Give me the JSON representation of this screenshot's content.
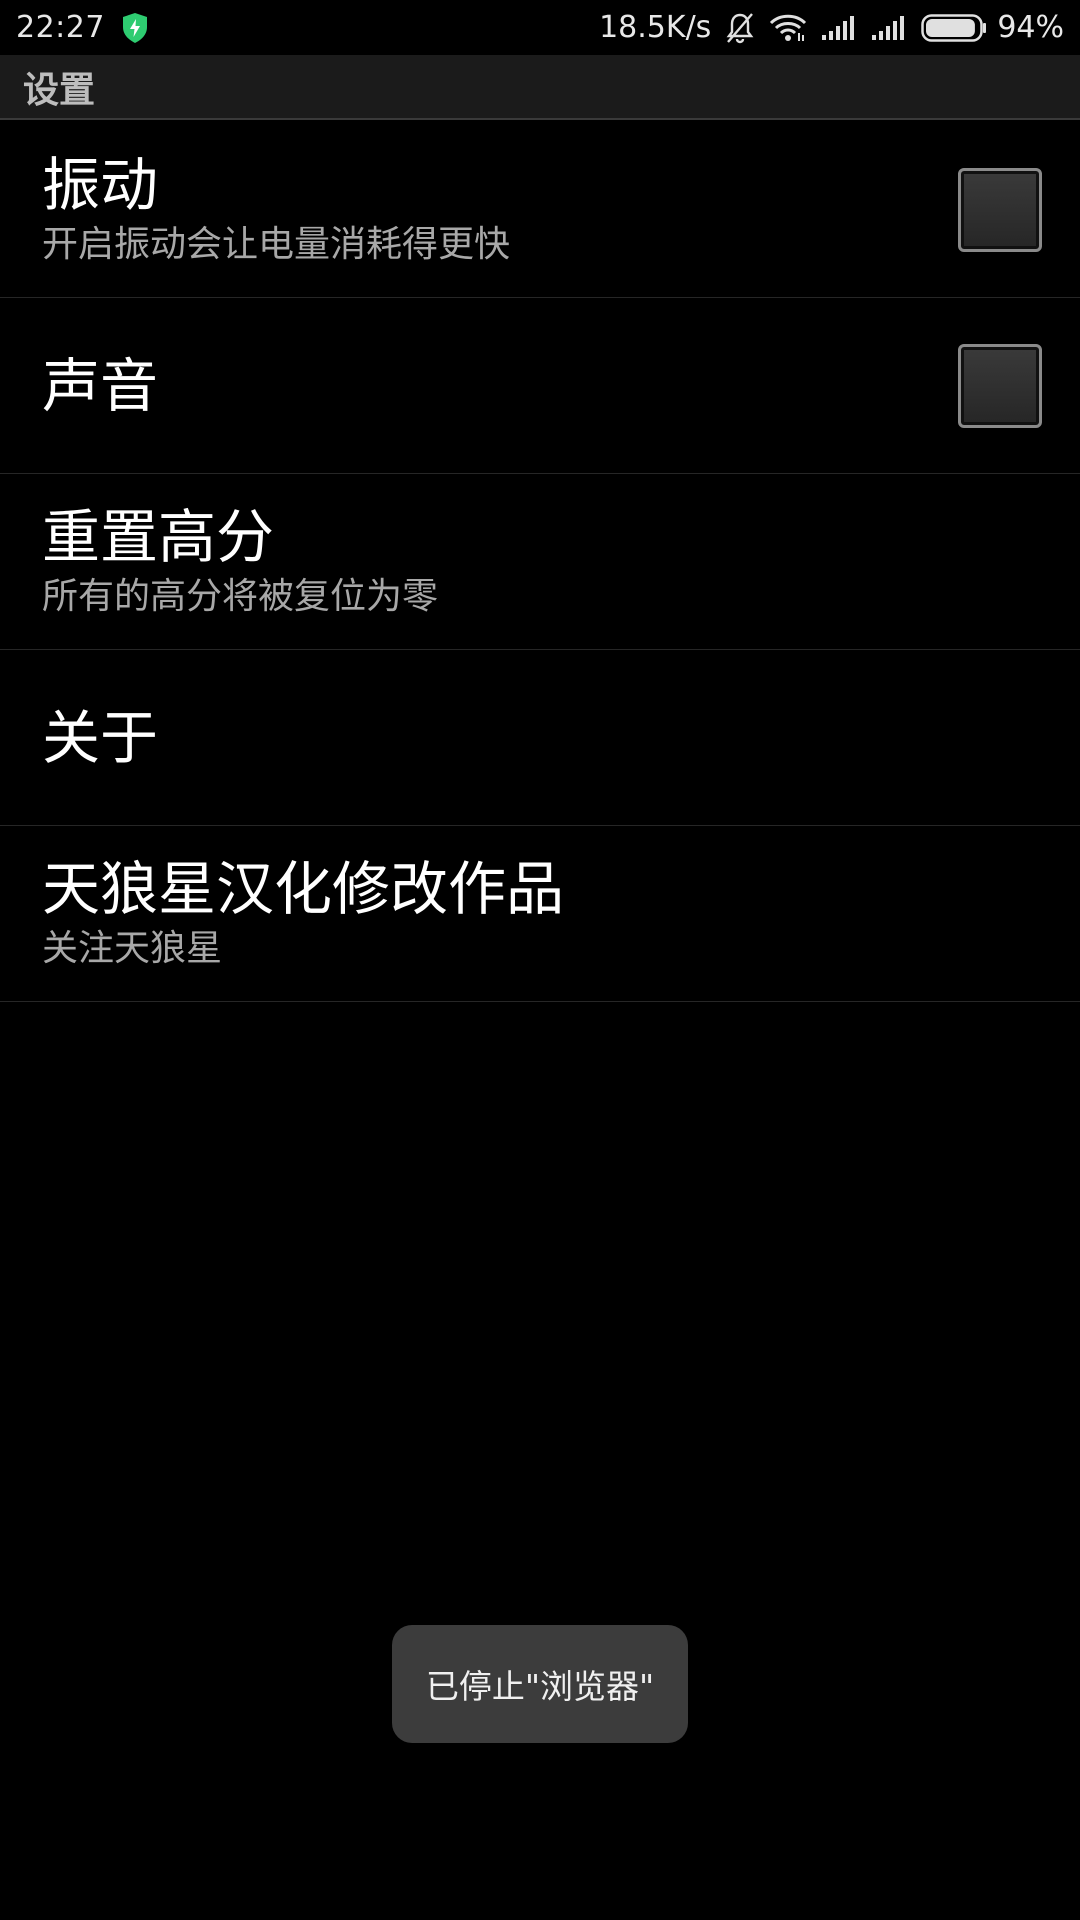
{
  "status_bar": {
    "time": "22:27",
    "net_speed": "18.5K/s",
    "battery_percent": "94%",
    "battery_level": 0.94,
    "icons": [
      "shield-bolt-icon",
      "bell-off-icon",
      "wifi-icon",
      "signal-icon",
      "signal-icon",
      "battery-icon"
    ],
    "shield_color": "#2ecc71"
  },
  "action_bar": {
    "title": "设置"
  },
  "preferences": [
    {
      "title": "振动",
      "summary": "开启振动会让电量消耗得更快",
      "checkbox": true,
      "checked": false
    },
    {
      "title": "声音",
      "summary": "",
      "checkbox": true,
      "checked": false
    },
    {
      "title": "重置高分",
      "summary": "所有的高分将被复位为零",
      "checkbox": false
    },
    {
      "title": "关于",
      "summary": "",
      "checkbox": false
    },
    {
      "title": "天狼星汉化修改作品",
      "summary": "关注天狼星",
      "checkbox": false
    }
  ],
  "toast": {
    "text": "已停止\"浏览器\""
  }
}
